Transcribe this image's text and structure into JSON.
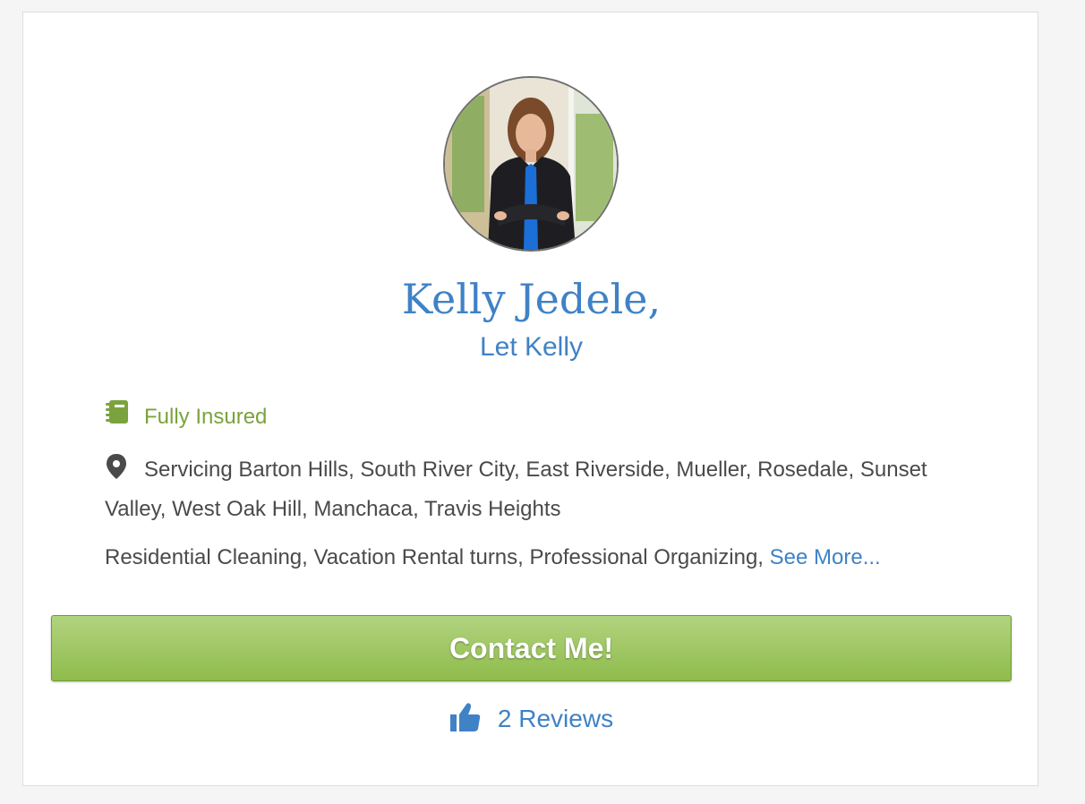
{
  "profile": {
    "name": "Kelly Jedele,",
    "business": "Let Kelly"
  },
  "badges": {
    "insured_label": "Fully Insured",
    "insured_icon": "insurance-book-icon",
    "insured_color": "#7aa33d"
  },
  "location": {
    "icon": "map-pin-icon",
    "text": "Servicing Barton Hills, South River City, East Riverside, Mueller, Rosedale, Sunset Valley, West Oak Hill, Manchaca, Travis Heights"
  },
  "services": {
    "text": "Residential Cleaning, Vacation Rental turns, Professional Organizing,",
    "see_more_label": "See More..."
  },
  "contact": {
    "button_label": "Contact Me!"
  },
  "reviews": {
    "label": "2 Reviews",
    "icon": "thumbs-up-icon"
  },
  "colors": {
    "accent_blue": "#3f82c6",
    "button_green": "#9cc35c",
    "text_gray": "#4a4a4a"
  }
}
